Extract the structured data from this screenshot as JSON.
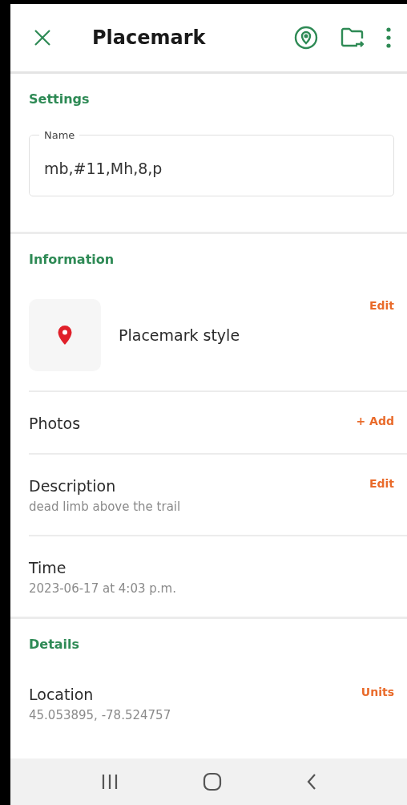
{
  "app_bar": {
    "title": "Placemark"
  },
  "sections": [
    {
      "kind": "settings",
      "heading": "Settings",
      "field": {
        "label": "Name",
        "value": "mb,#11,Mh,8,p"
      }
    },
    {
      "kind": "list",
      "heading": "Information",
      "rows": [
        {
          "kind": "style",
          "title": "Placemark style",
          "action": "Edit"
        },
        {
          "kind": "plain",
          "title": "Photos",
          "action": "+ Add"
        },
        {
          "kind": "plain",
          "title": "Description",
          "subtitle": "dead limb above the trail",
          "action": "Edit"
        },
        {
          "kind": "plain",
          "title": "Time",
          "subtitle": "2023-06-17 at 4:03 p.m."
        }
      ]
    },
    {
      "kind": "list",
      "heading": "Details",
      "rows": [
        {
          "kind": "plain",
          "title": "Location",
          "subtitle": "45.053895, -78.524757",
          "action": "Units"
        }
      ]
    }
  ]
}
